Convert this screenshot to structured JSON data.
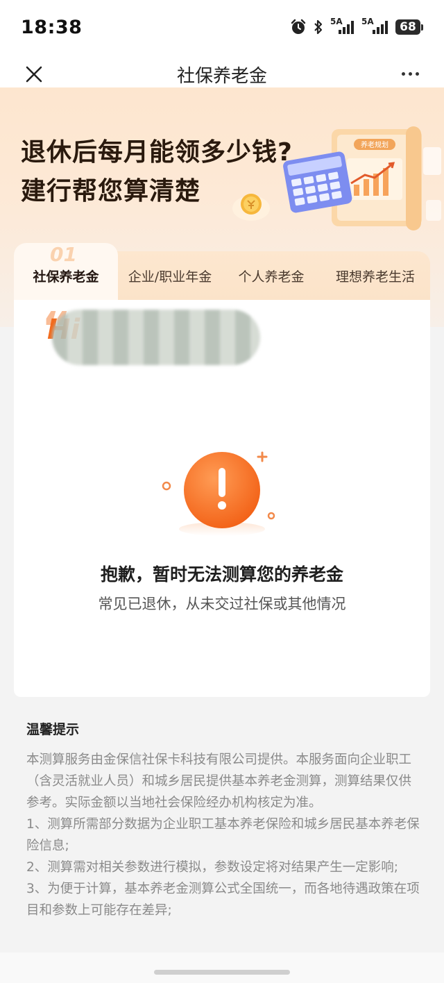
{
  "status_bar": {
    "time": "18:38",
    "signal_1_label": "5A",
    "signal_2_label": "5A",
    "battery": "68"
  },
  "nav": {
    "title": "社保养老金",
    "close_icon": "close-icon",
    "more_icon": "more-icon"
  },
  "hero": {
    "line1": "退休后每月能领多少钱?",
    "line2": "建行帮您算清楚",
    "badge_text": "养老规划"
  },
  "tabs": [
    {
      "label": "社保养老金",
      "number": "01",
      "active": true
    },
    {
      "label": "企业/职业年金",
      "active": false
    },
    {
      "label": "个人养老金",
      "active": false
    },
    {
      "label": "理想养老生活",
      "active": false
    }
  ],
  "card": {
    "greeting": "Hi",
    "error_title": "抱歉，暂时无法测算您的养老金",
    "error_subtitle": "常见已退休，从未交过社保或其他情况",
    "alert_icon": "alert-icon"
  },
  "tips": {
    "title": "温馨提示",
    "paragraphs": [
      "本测算服务由金保信社保卡科技有限公司提供。本服务面向企业职工（含灵活就业人员）和城乡居民提供基本养老金测算，测算结果仅供参考。实际金额以当地社会保险经办机构核定为准。",
      "1、测算所需部分数据为企业职工基本养老保险和城乡居民基本养老保险信息;",
      "2、测算需对相关参数进行模拟，参数设定将对结果产生一定影响;",
      "3、为便于计算，基本养老金测算公式全国统一，而各地待遇政策在项目和参数上可能存在差异;"
    ]
  },
  "colors": {
    "accent_orange": "#f26a1b",
    "hero_bg": "#fde6cf",
    "tips_text": "#8a8a8a"
  }
}
